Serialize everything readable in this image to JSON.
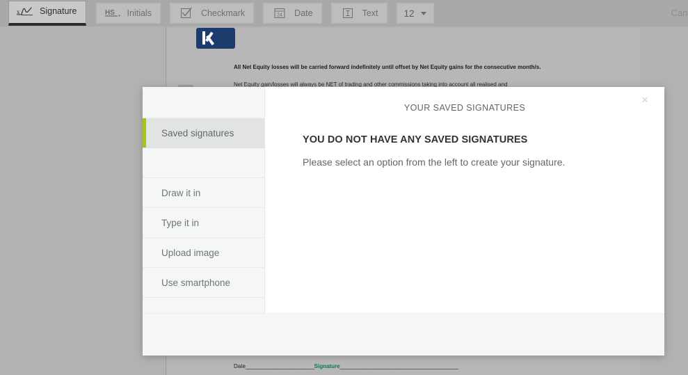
{
  "toolbar": {
    "tools": [
      {
        "id": "signature",
        "label": "Signature",
        "icon": "signature-icon",
        "active": true
      },
      {
        "id": "initials",
        "label": "Initials",
        "icon": "initials-icon",
        "active": false
      },
      {
        "id": "checkmark",
        "label": "Checkmark",
        "icon": "checkmark-icon",
        "active": false
      },
      {
        "id": "date",
        "label": "Date",
        "icon": "calendar-icon",
        "active": false
      },
      {
        "id": "text",
        "label": "Text",
        "icon": "text-cursor-icon",
        "active": false
      }
    ],
    "font_size": {
      "value": "12",
      "icon": "chevron-down-icon"
    },
    "cancel_label": "Cancel"
  },
  "document": {
    "logo": "company-logo",
    "paragraph_bold": "All Net Equity losses will be carried forward indefinitely until offset by Net Equity gains for the consecutive month/s.",
    "paragraph_body": "Net Equity gain/losses will always be NET of trading and other commissions taking into account all realised and",
    "signature_line": {
      "date_label": "Date",
      "date_rule": "_________________________",
      "signature_label": "Signature",
      "signature_rule": "___________________________________________"
    }
  },
  "modal": {
    "title": "YOUR SAVED SIGNATURES",
    "close_icon": "×",
    "sidebar": [
      {
        "id": "saved-signatures",
        "label": "Saved signatures",
        "active": true
      },
      {
        "id": "spacer",
        "label": "",
        "active": false
      },
      {
        "id": "draw-it-in",
        "label": "Draw it in",
        "active": false
      },
      {
        "id": "type-it-in",
        "label": "Type it in",
        "active": false
      },
      {
        "id": "upload-image",
        "label": "Upload image",
        "active": false
      },
      {
        "id": "use-smartphone",
        "label": "Use smartphone",
        "active": false
      }
    ],
    "empty_state": {
      "heading": "YOU DO NOT HAVE ANY SAVED SIGNATURES",
      "subtext": "Please select an option from the left to create your signature."
    }
  },
  "colors": {
    "accent_green": "#a2c617",
    "toolbar_bg": "#a9a9a9",
    "page_bg": "#b7b7b7",
    "modal_chrome": "#f5f7f7",
    "signature_green": "#0b7a4b",
    "logo_navy": "#1d3c6e"
  }
}
